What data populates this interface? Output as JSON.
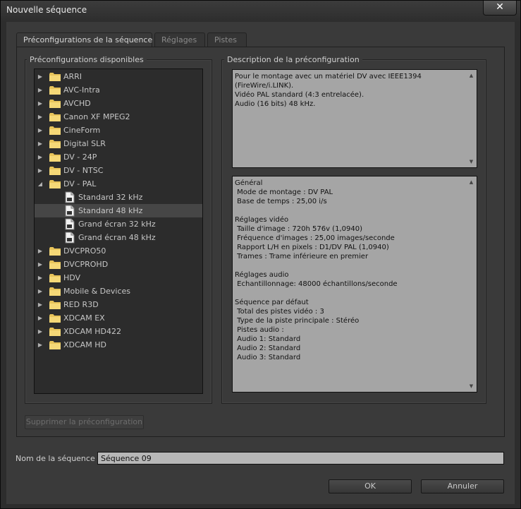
{
  "window": {
    "title": "Nouvelle séquence",
    "close_label": "✕"
  },
  "tabs": [
    {
      "label": "Préconfigurations de la séquence",
      "active": true
    },
    {
      "label": "Réglages",
      "active": false
    },
    {
      "label": "Pistes",
      "active": false
    }
  ],
  "presets": {
    "group_label": "Préconfigurations disponibles",
    "tree": [
      {
        "label": "ARRI",
        "type": "folder",
        "expanded": false
      },
      {
        "label": "AVC-Intra",
        "type": "folder",
        "expanded": false
      },
      {
        "label": "AVCHD",
        "type": "folder",
        "expanded": false
      },
      {
        "label": "Canon XF MPEG2",
        "type": "folder",
        "expanded": false
      },
      {
        "label": "CineForm",
        "type": "folder",
        "expanded": false
      },
      {
        "label": "Digital SLR",
        "type": "folder",
        "expanded": false
      },
      {
        "label": "DV - 24P",
        "type": "folder",
        "expanded": false
      },
      {
        "label": "DV - NTSC",
        "type": "folder",
        "expanded": false
      },
      {
        "label": "DV - PAL",
        "type": "folder",
        "expanded": true
      },
      {
        "label": "Standard 32 kHz",
        "type": "preset",
        "selected": false
      },
      {
        "label": "Standard 48 kHz",
        "type": "preset",
        "selected": true
      },
      {
        "label": "Grand écran 32 kHz",
        "type": "preset",
        "selected": false
      },
      {
        "label": "Grand écran 48 kHz",
        "type": "preset",
        "selected": false
      },
      {
        "label": "DVCPRO50",
        "type": "folder",
        "expanded": false
      },
      {
        "label": "DVCPROHD",
        "type": "folder",
        "expanded": false
      },
      {
        "label": "HDV",
        "type": "folder",
        "expanded": false
      },
      {
        "label": "Mobile & Devices",
        "type": "folder",
        "expanded": false
      },
      {
        "label": "RED R3D",
        "type": "folder",
        "expanded": false
      },
      {
        "label": "XDCAM EX",
        "type": "folder",
        "expanded": false
      },
      {
        "label": "XDCAM HD422",
        "type": "folder",
        "expanded": false
      },
      {
        "label": "XDCAM HD",
        "type": "folder",
        "expanded": false
      }
    ],
    "delete_button": "Supprimer la préconfiguration"
  },
  "description": {
    "group_label": "Description de la préconfiguration",
    "summary_lines": [
      "Pour le montage avec un matériel DV avec IEEE1394",
      "(FireWire/i.LINK).",
      "Vidéo PAL standard (4:3 entrelacée).",
      "Audio (16 bits) 48 kHz."
    ],
    "details_lines": [
      "Général",
      " Mode de montage : DV PAL",
      " Base de temps : 25,00 i/s",
      "",
      "Réglages vidéo",
      " Taille d'image : 720h 576v (1,0940)",
      " Fréquence d'images : 25,00 images/seconde",
      " Rapport L/H en pixels : D1/DV PAL (1,0940)",
      " Trames : Trame inférieure en premier",
      "",
      "Réglages audio",
      " Echantillonnage: 48000 échantillons/seconde",
      "",
      "Séquence par défaut",
      " Total des pistes vidéo : 3",
      " Type de la piste principale : Stéréo",
      " Pistes audio :",
      " Audio 1: Standard",
      " Audio 2: Standard",
      " Audio 3: Standard"
    ]
  },
  "sequence_name": {
    "label": "Nom de la séquence :",
    "value": "Séquence 09"
  },
  "buttons": {
    "ok": "OK",
    "cancel": "Annuler"
  },
  "colors": {
    "folder": "#e8c45a",
    "panel": "#3a3a3a",
    "text_area": "#a5a5a5"
  }
}
